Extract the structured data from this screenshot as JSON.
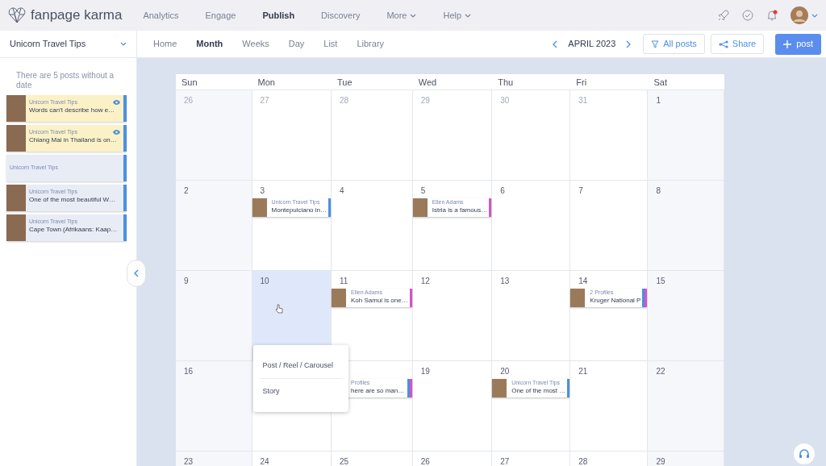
{
  "topbar": {
    "logo": "fanpage karma",
    "nav": [
      {
        "label": "Analytics",
        "selected": false,
        "dropdown": false
      },
      {
        "label": "Engage",
        "selected": false,
        "dropdown": false
      },
      {
        "label": "Publish",
        "selected": true,
        "dropdown": false
      },
      {
        "label": "Discovery",
        "selected": false,
        "dropdown": false
      },
      {
        "label": "More",
        "selected": false,
        "dropdown": true
      },
      {
        "label": "Help",
        "selected": false,
        "dropdown": true
      }
    ],
    "notifications_unread": true
  },
  "profile_select": {
    "value": "Unicorn Travel Tips"
  },
  "view_tabs": [
    {
      "label": "Home",
      "selected": false
    },
    {
      "label": "Month",
      "selected": true
    },
    {
      "label": "Weeks",
      "selected": false
    },
    {
      "label": "Day",
      "selected": false
    },
    {
      "label": "List",
      "selected": false
    },
    {
      "label": "Library",
      "selected": false
    }
  ],
  "period": "APRIL 2023",
  "filter_button": "All posts",
  "share_button": "Share",
  "new_post_button": "post",
  "sidebar": {
    "notice": "There are 5 posts without a date",
    "posts": [
      {
        "profile": "Unicorn Travel Tips",
        "text": "Words can’t describe how e…",
        "image": true,
        "highlighted": true,
        "preview": true,
        "color": "#4a90e2"
      },
      {
        "profile": "Unicorn Travel Tips",
        "text": "Chiang Mai in Thailand is on…",
        "image": true,
        "highlighted": true,
        "preview": true,
        "color": "#4a90e2"
      },
      {
        "profile": "Unicorn Travel Tips",
        "image": false,
        "highlighted": false,
        "preview": false,
        "color": "#4a90e2"
      },
      {
        "profile": "Unicorn Travel Tips",
        "text": "One of the most beautiful W…",
        "image": true,
        "highlighted": false,
        "preview": false,
        "color": "#4a90e2"
      },
      {
        "profile": "Unicorn Travel Tips",
        "text": "Cape Town (Afrikaans: Kaap…",
        "image": true,
        "highlighted": false,
        "preview": false,
        "color": "#4a90e2"
      }
    ]
  },
  "calendar": {
    "weekdays": [
      "Sun",
      "Mon",
      "Tue",
      "Wed",
      "Thu",
      "Fri",
      "Sat"
    ],
    "weeks": [
      [
        {
          "day": "26",
          "outside": true,
          "selected": false
        },
        {
          "day": "27",
          "outside": true,
          "selected": false
        },
        {
          "day": "28",
          "outside": true,
          "selected": false
        },
        {
          "day": "29",
          "outside": true,
          "selected": false
        },
        {
          "day": "30",
          "outside": true,
          "selected": false
        },
        {
          "day": "31",
          "outside": true,
          "selected": false
        },
        {
          "day": "1",
          "outside": false,
          "selected": false
        }
      ],
      [
        {
          "day": "2",
          "outside": false,
          "selected": false
        },
        {
          "day": "3",
          "outside": false,
          "selected": false,
          "posts": [
            {
              "profile": "Unicorn Travel Tips",
              "text": "Montepulciano in…",
              "stripes": [
                {
                  "color": "#4a90e2"
                }
              ]
            }
          ]
        },
        {
          "day": "4",
          "outside": false,
          "selected": false
        },
        {
          "day": "5",
          "outside": false,
          "selected": false,
          "posts": [
            {
              "profile": "Ellen Adams",
              "text": "Istria is a famous…",
              "stripes": [
                {
                  "color": "#d653c7"
                }
              ]
            }
          ]
        },
        {
          "day": "6",
          "outside": false,
          "selected": false
        },
        {
          "day": "7",
          "outside": false,
          "selected": false
        },
        {
          "day": "8",
          "outside": false,
          "selected": false
        }
      ],
      [
        {
          "day": "9",
          "outside": false,
          "selected": false
        },
        {
          "day": "10",
          "outside": false,
          "selected": true
        },
        {
          "day": "11",
          "outside": false,
          "selected": false,
          "posts": [
            {
              "profile": "Ellen Adams",
              "text": "Koh Samui is one…",
              "stripes": [
                {
                  "color": "#d653c7"
                }
              ]
            }
          ]
        },
        {
          "day": "12",
          "outside": false,
          "selected": false
        },
        {
          "day": "13",
          "outside": false,
          "selected": false
        },
        {
          "day": "14",
          "outside": false,
          "selected": false,
          "posts": [
            {
              "profile": "2 Profiles",
              "text": "Kruger National P",
              "stripes": [
                {
                  "color": "#4a90e2"
                },
                {
                  "color": "#d653c7"
                }
              ]
            }
          ]
        },
        {
          "day": "15",
          "outside": false,
          "selected": false
        }
      ],
      [
        {
          "day": "16",
          "outside": false,
          "selected": false
        },
        {
          "selected": false,
          "menu": [
            "Post / Reel / Carousel",
            "Story"
          ]
        },
        {
          "selected": false,
          "posts": [
            {
              "profile": "Profiles",
              "text": "here are so man…",
              "stripes": [
                {
                  "color": "#4a90e2"
                },
                {
                  "color": "#d653c7"
                }
              ]
            }
          ]
        },
        {
          "day": "19",
          "outside": false,
          "selected": false
        },
        {
          "day": "20",
          "outside": false,
          "selected": false,
          "posts": [
            {
              "profile": "Unicorn Travel Tips",
              "text": "One of the most …",
              "stripes": [
                {
                  "color": "#4a90e2"
                }
              ]
            }
          ]
        },
        {
          "day": "21",
          "outside": false,
          "selected": false
        },
        {
          "day": "22",
          "outside": false,
          "selected": false
        }
      ],
      [
        {
          "day": "23",
          "outside": false,
          "selected": false
        },
        {
          "day": "24",
          "outside": false,
          "selected": false
        },
        {
          "day": "25",
          "outside": false,
          "selected": false
        },
        {
          "day": "26",
          "outside": false,
          "selected": false
        },
        {
          "day": "27",
          "outside": false,
          "selected": false
        },
        {
          "day": "28",
          "outside": false,
          "selected": false
        },
        {
          "day": "29",
          "outside": false,
          "selected": false
        }
      ]
    ]
  }
}
